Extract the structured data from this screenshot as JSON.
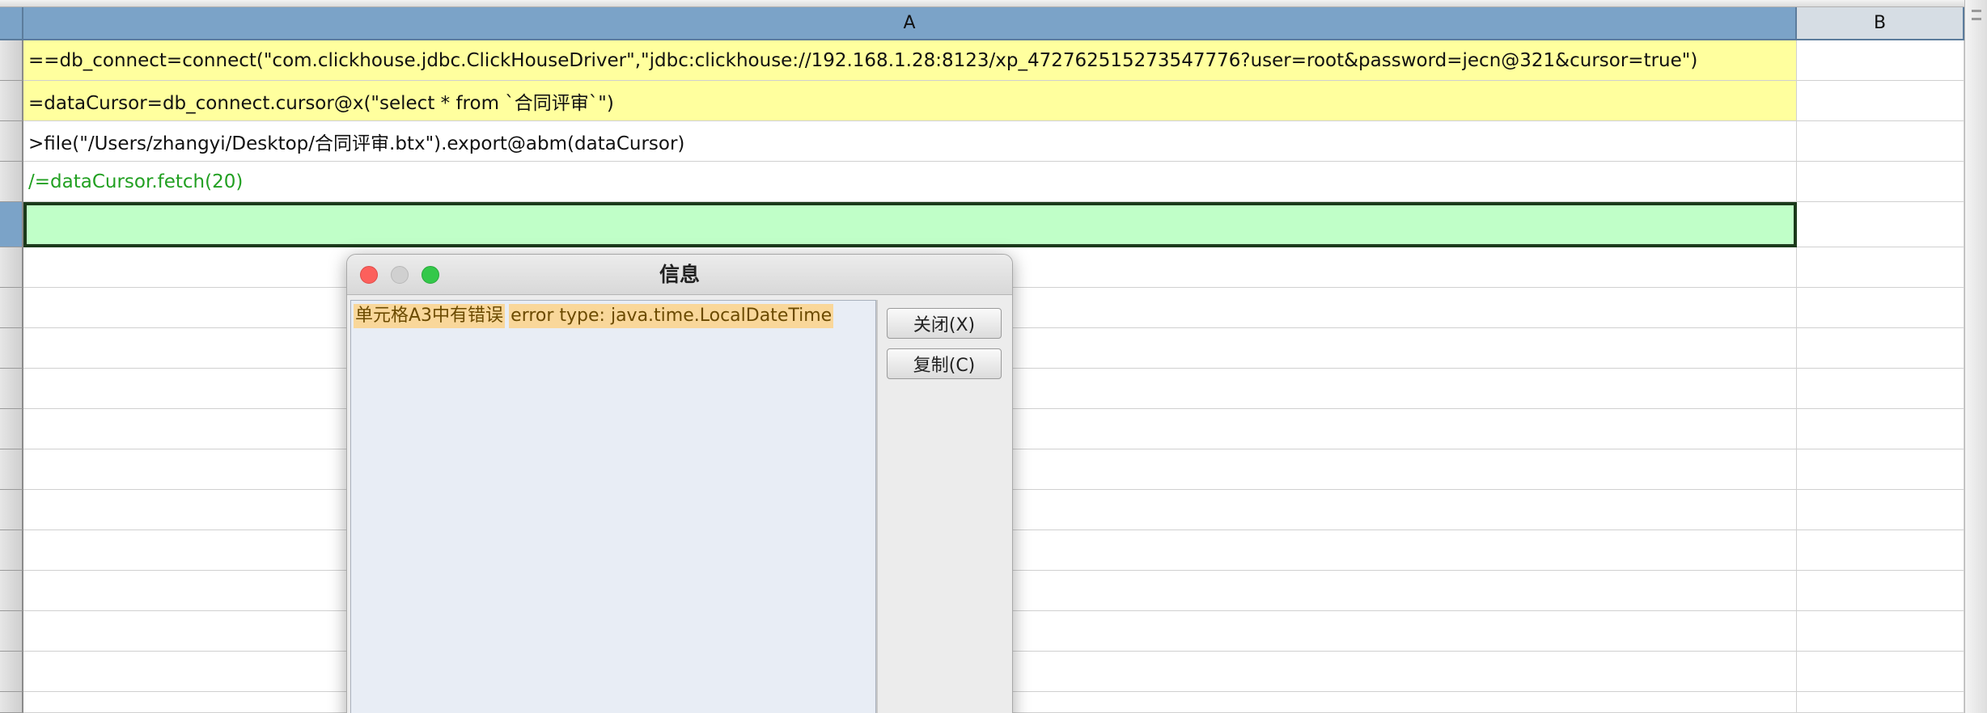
{
  "columns": {
    "a": "A",
    "b": "B"
  },
  "cells": {
    "a1": "==db_connect=connect(\"com.clickhouse.jdbc.ClickHouseDriver\",\"jdbc:clickhouse://192.168.1.28:8123/xp_472762515273547776?user=root&password=jecn@321&cursor=true\")",
    "a2": "=dataCursor=db_connect.cursor@x(\"select * from `合同评审`\")",
    "a3": ">file(\"/Users/zhangyi/Desktop/合同评审.btx\").export@abm(dataCursor)",
    "a4": "/=dataCursor.fetch(20)",
    "a5": ""
  },
  "dialog": {
    "title": "信息",
    "message_line1": "单元格A3中有错误",
    "message_line2": "error type: java.time.LocalDateTime",
    "close_button": "关闭(X)",
    "copy_button": "复制(C)"
  },
  "colors": {
    "header_blue": "#7ba3c8",
    "formula_yellow": "#ffff9e",
    "active_green": "#c0ffc8",
    "comment_green": "#22a022",
    "message_highlight": "#f9d79a"
  }
}
